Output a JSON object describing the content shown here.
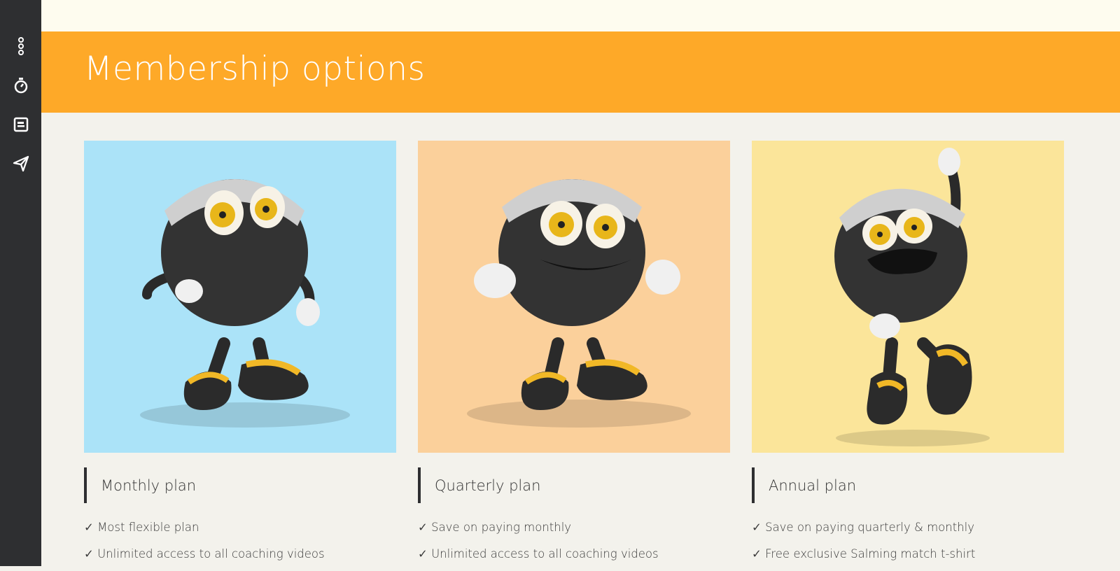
{
  "sidebar": {
    "items": [
      {
        "icon": "menu-dots-icon"
      },
      {
        "icon": "stopwatch-icon"
      },
      {
        "icon": "article-icon"
      },
      {
        "icon": "send-icon"
      }
    ]
  },
  "hero": {
    "title": "Membership options"
  },
  "plans": [
    {
      "name": "Monthly plan",
      "image_bg": "#abe3f8",
      "features": [
        "✓ Most flexible plan",
        "✓ Unlimited access to all coaching videos"
      ]
    },
    {
      "name": "Quarterly plan",
      "image_bg": "#fbd09b",
      "features": [
        "✓ Save on paying monthly",
        "✓ Unlimited access to all coaching videos"
      ]
    },
    {
      "name": "Annual plan",
      "image_bg": "#fbe59a",
      "features": [
        "✓ Save on paying quarterly & monthly",
        "✓ Free exclusive Salming match t-shirt"
      ]
    }
  ],
  "colors": {
    "sidebar": "#2e2f31",
    "hero": "#fea928",
    "page": "#f3f2ec",
    "topstrip": "#fefcef"
  }
}
